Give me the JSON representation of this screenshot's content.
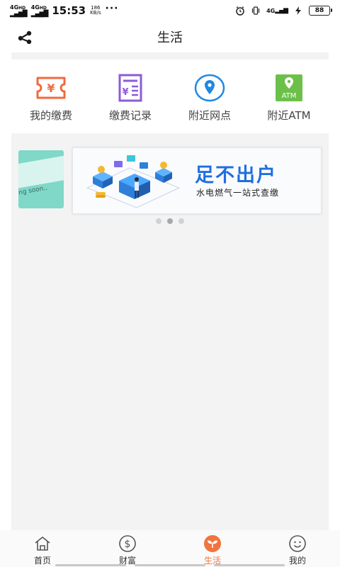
{
  "status_bar": {
    "net1": "4G",
    "net1_sup": "HD",
    "net2": "4G",
    "net2_sup": "HD",
    "time": "15:53",
    "speed_value": "186",
    "speed_unit": "KB/s",
    "more": "···",
    "right_net": "4G",
    "battery": "88",
    "icons": [
      "alarm-icon",
      "vibrate-icon",
      "signal-icon",
      "charging-icon",
      "battery-icon"
    ]
  },
  "header": {
    "title": "生活",
    "share_icon": "share-icon"
  },
  "functions": [
    {
      "label": "我的缴费",
      "icon": "ticket-yen-icon",
      "color": "#f06a3c"
    },
    {
      "label": "缴费记录",
      "icon": "bill-record-icon",
      "color": "#8c5bd8"
    },
    {
      "label": "附近网点",
      "icon": "location-pin-icon",
      "color": "#1e88e5"
    },
    {
      "label": "附近ATM",
      "icon": "atm-pin-icon",
      "color": "#6cc04a"
    }
  ],
  "carousel": {
    "prev_slide_text": "ng soon..",
    "headline": "足不出户",
    "subline": "水电燃气一站式查缴",
    "dots": 3,
    "active_dot": 1,
    "accent": "#1f6fe0"
  },
  "bottom_nav": {
    "items": [
      {
        "label": "首页",
        "icon": "home-icon",
        "active": false
      },
      {
        "label": "财富",
        "icon": "dollar-coin-icon",
        "active": false
      },
      {
        "label": "生活",
        "icon": "sprout-icon",
        "active": true
      },
      {
        "label": "我的",
        "icon": "smiley-face-icon",
        "active": false
      }
    ],
    "active_color": "#f0743e"
  }
}
